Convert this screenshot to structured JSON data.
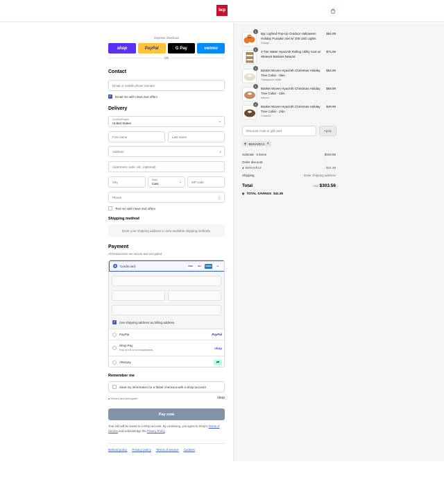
{
  "header": {
    "logo_text": "bcp",
    "bag_icon": "shopping-bag-icon"
  },
  "express": {
    "label": "Express checkout",
    "buttons": [
      {
        "label": "shop",
        "color": "#5a31f4"
      },
      {
        "label": "PayPal",
        "color": "#ffc439"
      },
      {
        "label": "G Pay",
        "color": "#000000"
      },
      {
        "label": "venmo",
        "color": "#008cff"
      }
    ],
    "or_label": "OR"
  },
  "contact": {
    "title": "Contact",
    "email_placeholder": "Email or mobile phone number",
    "newsletter_label": "Email me with news and offers",
    "newsletter_checked": true
  },
  "delivery": {
    "title": "Delivery",
    "country_label": "Country/Region",
    "country_value": "United States",
    "first_name": "First name",
    "last_name": "Last name",
    "address": "Address",
    "apartment": "Apartment, suite, etc. (optional)",
    "city": "City",
    "state_label": "State",
    "state_value": "Iowa",
    "zip": "ZIP code",
    "phone": "Phone",
    "text_offers_label": "Text me with news and offers"
  },
  "shipping": {
    "title": "Shipping method",
    "info": "Enter your shipping address to view available shipping methods."
  },
  "payment": {
    "title": "Payment",
    "subtitle": "All transactions are secure and encrypted.",
    "credit_card_label": "Credit card",
    "card_brands": [
      "VISA",
      "MC",
      "AMEX",
      "+4"
    ],
    "billing_label": "Use shipping address as billing address",
    "paypal_label": "PayPal",
    "paypal_logo": "PayPal",
    "shoppay_label": "Shop Pay",
    "shoppay_sub": "Pay in full or in installments",
    "shoppay_logo": "shop",
    "afterpay_label": "Afterpay"
  },
  "remember": {
    "title": "Remember me",
    "save_label": "Save my information for a faster checkout with a Shop account",
    "secure_label": "Secure and encrypted",
    "shop_logo": "shop"
  },
  "pay_now_label": "Pay now",
  "legal": {
    "text1": "Your info will be saved to a Shop account. By continuing, you agree to Shop's",
    "terms": "Terms of Service",
    "text2": " and acknowledge the ",
    "privacy": "Privacy Policy",
    "text3": "."
  },
  "footer_links": [
    "Refund policy",
    "Privacy policy",
    "Terms of service",
    "Cookies"
  ],
  "cart": {
    "items": [
      {
        "qty": "1",
        "name": "6pc Lighted Pop-Up Outdoor Halloween Holiday Pumpkin Set w/ 100 LED Lights",
        "variant": "Orange",
        "price": "$84.99",
        "thumb_color": "#e8782a"
      },
      {
        "qty": "1",
        "name": "3-Tier Water Hyacinth Rolling Utility Cart w/ Weaved Baskets Natural",
        "variant": "",
        "price": "$74.99",
        "thumb_color": "#b08a5a"
      },
      {
        "qty": "1",
        "name": "Basket Woven Hyacinth Christmas Holiday Tree Collar - 36in",
        "variant": "Transparent White",
        "price": "$64.99",
        "thumb_color": "#e8dccb"
      },
      {
        "qty": "1",
        "name": "Basket Woven Hyacinth Christmas Holiday Tree Collar - 42in",
        "variant": "Natural",
        "price": "$69.99",
        "thumb_color": "#c09060"
      },
      {
        "qty": "1",
        "name": "Basket Woven Hyacinth Christmas Holiday Tree Collar - 24in",
        "variant": "Chestnut",
        "price": "$49.99",
        "thumb_color": "#6b4a2b"
      }
    ],
    "discount_placeholder": "Discount code or gift card",
    "apply_label": "Apply",
    "applied_code": "BDSAVE12",
    "subtotal_label": "Subtotal · 5 items",
    "subtotal_value": "$344.95",
    "order_discount_label": "Order discount",
    "discount_code": "BDSAVE12",
    "discount_value": "- $41.39",
    "shipping_label": "Shipping",
    "shipping_value": "Enter shipping address",
    "total_label": "Total",
    "currency": "USD",
    "total_value": "$303.56",
    "savings_label": "TOTAL SAVINGS",
    "savings_value": "$41.39"
  }
}
